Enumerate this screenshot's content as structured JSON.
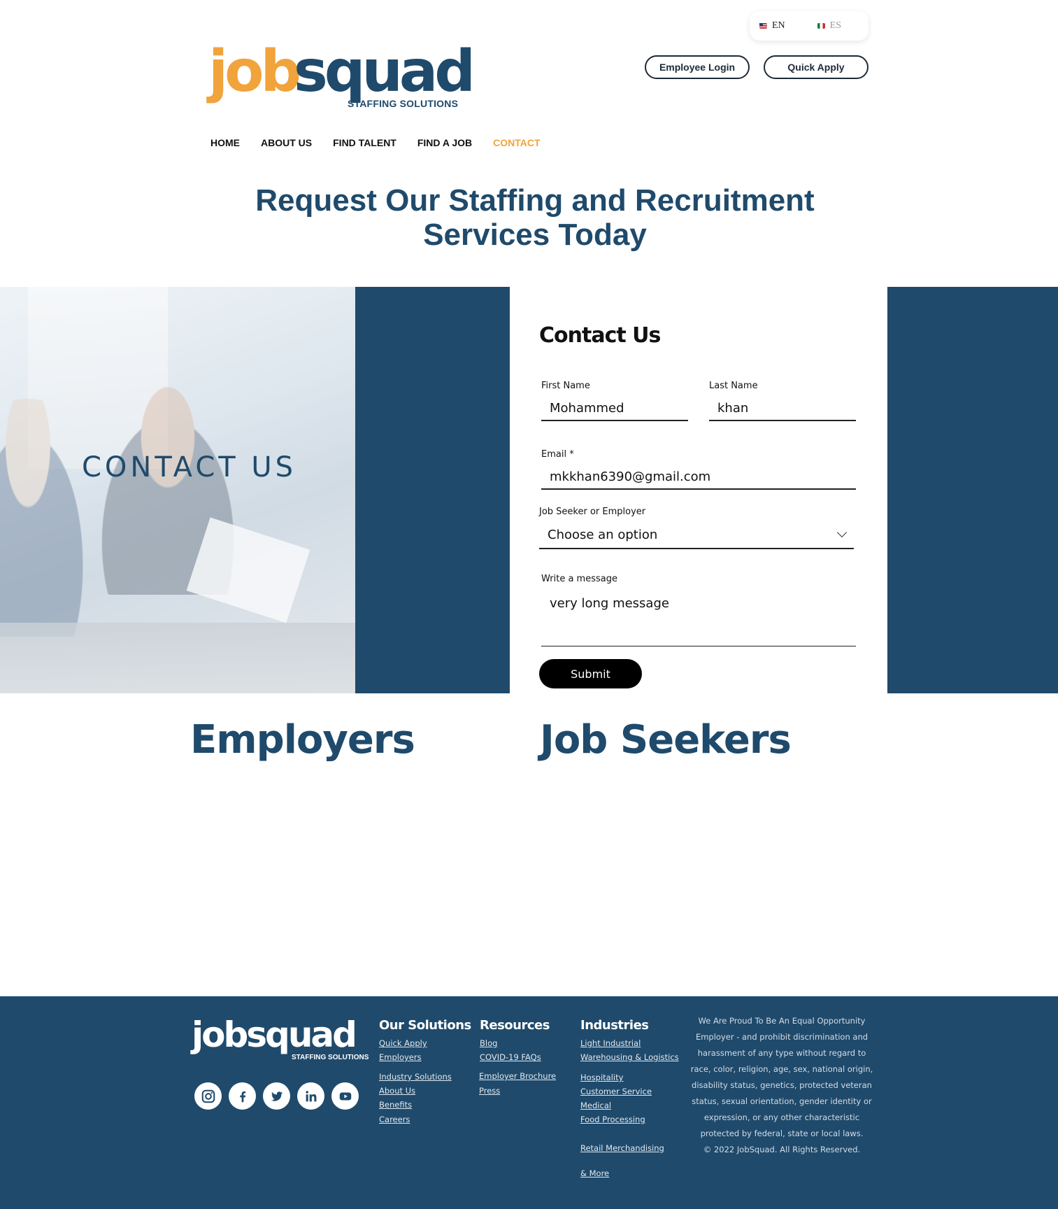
{
  "language": {
    "en": "EN",
    "es": "ES"
  },
  "header": {
    "employee_login": "Employee Login",
    "quick_apply": "Quick Apply",
    "logo_job": "job",
    "logo_squad": "squad",
    "logo_sub": "STAFFING SOLUTIONS"
  },
  "nav": {
    "items": [
      {
        "label": "HOME"
      },
      {
        "label": "ABOUT US"
      },
      {
        "label": "FIND TALENT"
      },
      {
        "label": "FIND A JOB"
      },
      {
        "label": "CONTACT",
        "active": true
      }
    ]
  },
  "headline": "Request Our Staffing and Recruitment Services Today",
  "contact_band": {
    "photo_title": "CONTACT US"
  },
  "form": {
    "title": "Contact Us",
    "first_name": {
      "label": "First Name",
      "value": "Mohammed"
    },
    "last_name": {
      "label": "Last Name",
      "value": "khan"
    },
    "email": {
      "label": "Email *",
      "value": "mkkhan6390@gmail.com"
    },
    "type": {
      "label": "Job Seeker or Employer",
      "value": "Choose an option"
    },
    "message": {
      "label": "Write a message",
      "value": "very long message"
    },
    "submit": "Submit"
  },
  "sections": {
    "employers": "Employers",
    "job_seekers": "Job Seekers"
  },
  "footer": {
    "logo": "jobsquad",
    "logo_sub": "STAFFING SOLUTIONS",
    "socials": [
      "instagram-icon",
      "facebook-icon",
      "twitter-icon",
      "linkedin-icon",
      "youtube-icon"
    ],
    "our_solutions": {
      "title": "Our Solutions",
      "links": [
        "Quick Apply",
        "Employers",
        "Industry Solutions",
        "About Us",
        "Benefits",
        "Careers"
      ]
    },
    "resources": {
      "title": "Resources",
      "links": [
        "Blog",
        "COVID-19 FAQs",
        "Employer Brochure",
        "Press"
      ]
    },
    "industries": {
      "title": "Industries",
      "links": [
        "Light Industrial",
        "Warehousing & Logistics",
        "Hospitality",
        "Customer Service",
        "Medical",
        "Food Processing",
        "Retail Merchandising",
        "& More"
      ]
    },
    "eeo": "We Are Proud To Be An Equal Opportunity Employer - and prohibit discrimination and harassment of any type without regard to race, color, religion, age, sex, national origin, disability status, genetics, protected veteran status, sexual orientation, gender identity or expression, or any other characteristic protected by federal, state or local laws.",
    "copyright": "© 2022 JobSquad. All Rights Reserved."
  },
  "colors": {
    "navy": "#1f4a6b",
    "orange": "#f1a33c",
    "black": "#000000"
  }
}
